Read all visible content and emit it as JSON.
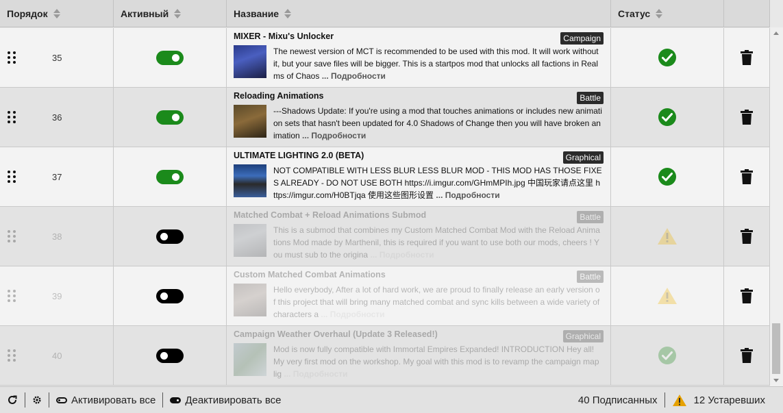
{
  "columns": {
    "order": "Порядок",
    "active": "Активный",
    "name": "Название",
    "status": "Статус"
  },
  "more_label": "... Подробности",
  "rows": [
    {
      "order": "35",
      "enabled": true,
      "dim": false,
      "title": "MIXER - Mixu's Unlocker",
      "tag": "Campaign",
      "desc": "The newest version of MCT is recommended to be used with this mod. It will work without it, but your save files will be bigger.  This is a startpos mod that unlocks all factions in Realms of Chaos",
      "status": "ok"
    },
    {
      "order": "36",
      "enabled": true,
      "dim": false,
      "title": "Reloading Animations",
      "tag": "Battle",
      "desc": "---Shadows Update: If you're using a mod that touches animations or includes new animation sets that hasn't been updated for 4.0 Shadows of Change then you will have broken animation",
      "status": "ok"
    },
    {
      "order": "37",
      "enabled": true,
      "dim": false,
      "title": "ULTIMATE LIGHTING 2.0 (BETA)",
      "tag": "Graphical",
      "desc": "NOT COMPATIBLE WITH LESS BLUR LESS BLUR MOD - THIS MOD HAS THOSE FIXES ALREADY - DO NOT USE BOTH  https://i.imgur.com/GHmMPIh.jpg  中国玩家请点这里 https://imgur.com/H0BTjqa 使用这些图形设置",
      "status": "ok"
    },
    {
      "order": "38",
      "enabled": false,
      "dim": true,
      "title": "Matched Combat + Reload Animations Submod",
      "tag": "Battle",
      "desc": "This is a submod that combines my Custom Matched Combat Mod with the Reload Animations Mod made by Marthenil, this is required if you want to use both our mods, cheers !  You must sub to the origina",
      "status": "warn"
    },
    {
      "order": "39",
      "enabled": false,
      "dim": true,
      "title": "Custom Matched Combat Animations",
      "tag": "Battle",
      "desc": "Hello everybody,  After a lot of hard work, we are proud to finally release an early version of this project that will bring many matched combat and sync kills between a wide variety of characters a",
      "status": "warn"
    },
    {
      "order": "40",
      "enabled": false,
      "dim": true,
      "title": "Campaign Weather Overhaul (Update 3 Released!)",
      "tag": "Graphical",
      "desc": "Mod is now fully compatible with Immortal Empires Expanded!   INTRODUCTION   Hey all! My very first mod on the workshop. My goal with this mod is to revamp the campaign map lig",
      "status": "ok"
    }
  ],
  "footer": {
    "activate_all": "Активировать все",
    "deactivate_all": "Деактивировать все",
    "subscribed": "40 Подписанных",
    "outdated": "12 Устаревших"
  },
  "colors": {
    "toggle_on": "#1b8a1b",
    "status_ok": "#1b8a1b",
    "status_warn": "#f0b400"
  }
}
